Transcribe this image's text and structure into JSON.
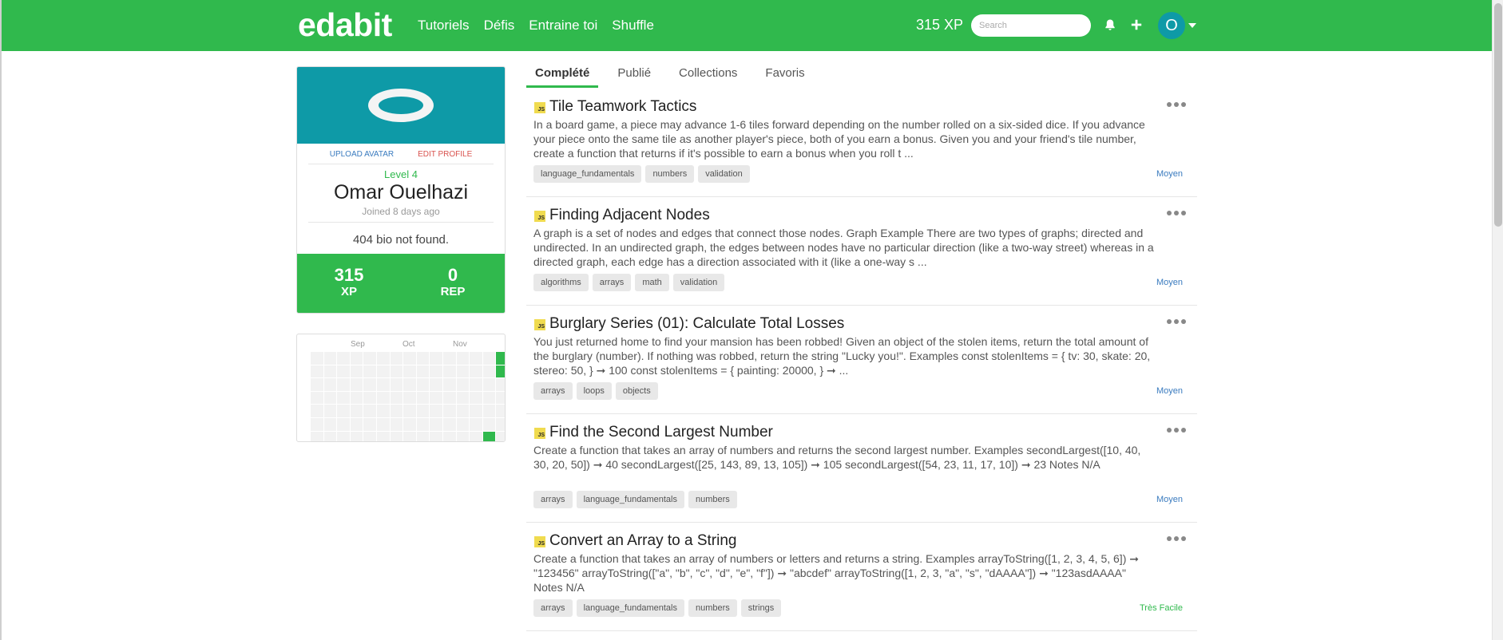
{
  "navbar": {
    "logo": "edabit",
    "links": [
      "Tutoriels",
      "Défis",
      "Entraine toi",
      "Shuffle"
    ],
    "xp": "315 XP",
    "search_placeholder": "Search",
    "bell_icon": "bell-icon",
    "plus_icon": "plus-icon",
    "avatar_letter": "O"
  },
  "profile": {
    "upload_avatar": "UPLOAD AVATAR",
    "edit_profile": "EDIT PROFILE",
    "level": "Level 4",
    "name": "Omar Ouelhazi",
    "joined": "Joined 8 days ago",
    "bio": "404 bio not found.",
    "xp_value": "315",
    "xp_label": "XP",
    "rep_value": "0",
    "rep_label": "REP"
  },
  "heatmap": {
    "months": [
      "Sep",
      "Oct",
      "Nov"
    ],
    "active_cells": [
      [
        14,
        0
      ],
      [
        14,
        1
      ],
      [
        13,
        6
      ]
    ]
  },
  "tabs": [
    "Complété",
    "Publié",
    "Collections",
    "Favoris"
  ],
  "active_tab": "Complété",
  "challenges": [
    {
      "language": "JS",
      "title": "Tile Teamwork Tactics",
      "description": "In a board game, a piece may advance 1-6 tiles forward depending on the number rolled on a six-sided dice. If you advance your piece onto the same tile as another player's piece, both of you earn a bonus. Given you and your friend's tile number, create a function that returns if it's possible to earn a bonus when you roll t ...",
      "tags": [
        "language_fundamentals",
        "numbers",
        "validation"
      ],
      "difficulty": "Moyen",
      "difficulty_color": "#3a7bbf"
    },
    {
      "language": "JS",
      "title": "Finding Adjacent Nodes",
      "description": "A graph is a set of nodes and edges that connect those nodes. Graph Example There are two types of graphs; directed and undirected. In an undirected graph, the edges between nodes have no particular direction (like a two-way street) whereas in a directed graph, each edge has a direction associated with it (like a one-way s ...",
      "tags": [
        "algorithms",
        "arrays",
        "math",
        "validation"
      ],
      "difficulty": "Moyen",
      "difficulty_color": "#3a7bbf"
    },
    {
      "language": "JS",
      "title": "Burglary Series (01): Calculate Total Losses",
      "description": "You just returned home to find your mansion has been robbed! Given an object of the stolen items, return the total amount of the burglary (number). If nothing was robbed, return the string \"Lucky you!\". Examples const stolenItems = { tv: 30, skate: 20, stereo: 50, } ➞ 100 const stolenItems = { painting: 20000, } ➞ ...",
      "tags": [
        "arrays",
        "loops",
        "objects"
      ],
      "difficulty": "Moyen",
      "difficulty_color": "#3a7bbf"
    },
    {
      "language": "JS",
      "title": "Find the Second Largest Number",
      "description": "Create a function that takes an array of numbers and returns the second largest number. Examples secondLargest([10, 40, 30, 20, 50]) ➞ 40 secondLargest([25, 143, 89, 13, 105]) ➞ 105 secondLargest([54, 23, 11, 17, 10]) ➞ 23 Notes N/A",
      "tags": [
        "arrays",
        "language_fundamentals",
        "numbers"
      ],
      "difficulty": "Moyen",
      "difficulty_color": "#3a7bbf"
    },
    {
      "language": "JS",
      "title": "Convert an Array to a String",
      "description": "Create a function that takes an array of numbers or letters and returns a string. Examples arrayToString([1, 2, 3, 4, 5, 6]) ➞ \"123456\" arrayToString([\"a\", \"b\", \"c\", \"d\", \"e\", \"f\"]) ➞ \"abcdef\" arrayToString([1, 2, 3, \"a\", \"s\", \"dAAAA\"]) ➞ \"123asdAAAA\" Notes N/A",
      "tags": [
        "arrays",
        "language_fundamentals",
        "numbers",
        "strings"
      ],
      "difficulty": "Très Facile",
      "difficulty_color": "#30b94d"
    }
  ]
}
